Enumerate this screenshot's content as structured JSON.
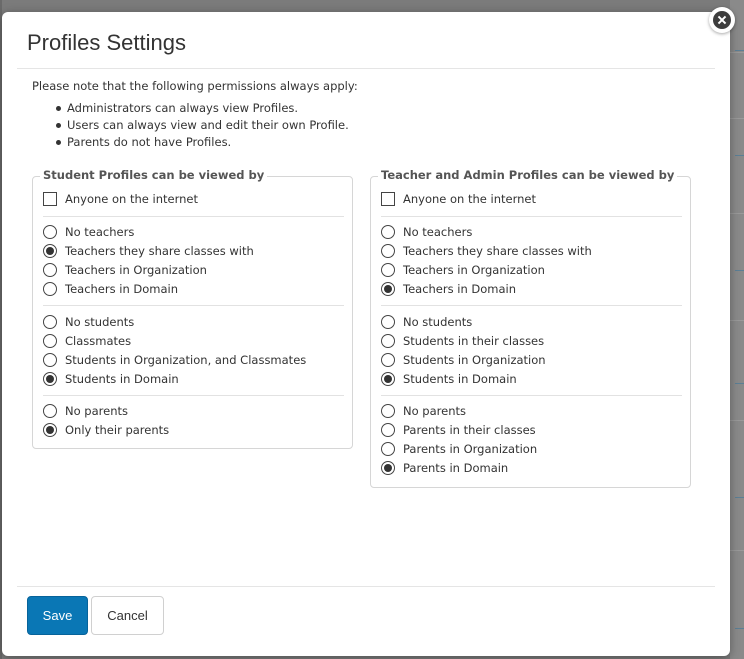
{
  "dialog": {
    "title": "Profiles Settings",
    "intro": "Please note that the following permissions always apply:",
    "rules": [
      "Administrators can always view Profiles.",
      "Users can always view and edit their own Profile.",
      "Parents do not have Profiles."
    ]
  },
  "student_panel": {
    "legend": "Student Profiles can be viewed by",
    "anyone_label": "Anyone on the internet",
    "anyone_checked": false,
    "teachers": [
      "No teachers",
      "Teachers they share classes with",
      "Teachers in Organization",
      "Teachers in Domain"
    ],
    "teachers_selected": "Teachers they share classes with",
    "students": [
      "No students",
      "Classmates",
      "Students in Organization, and Classmates",
      "Students in Domain"
    ],
    "students_selected": "Students in Domain",
    "parents": [
      "No parents",
      "Only their parents"
    ],
    "parents_selected": "Only their parents"
  },
  "staff_panel": {
    "legend": "Teacher and Admin Profiles can be viewed by",
    "anyone_label": "Anyone on the internet",
    "anyone_checked": false,
    "teachers": [
      "No teachers",
      "Teachers they share classes with",
      "Teachers in Organization",
      "Teachers in Domain"
    ],
    "teachers_selected": "Teachers in Domain",
    "students": [
      "No students",
      "Students in their classes",
      "Students in Organization",
      "Students in Domain"
    ],
    "students_selected": "Students in Domain",
    "parents": [
      "No parents",
      "Parents in their classes",
      "Parents in Organization",
      "Parents in Domain"
    ],
    "parents_selected": "Parents in Domain"
  },
  "footer": {
    "save_label": "Save",
    "cancel_label": "Cancel"
  },
  "colors": {
    "primary": "#0a77b5",
    "overlay": "#7b7b7b"
  }
}
